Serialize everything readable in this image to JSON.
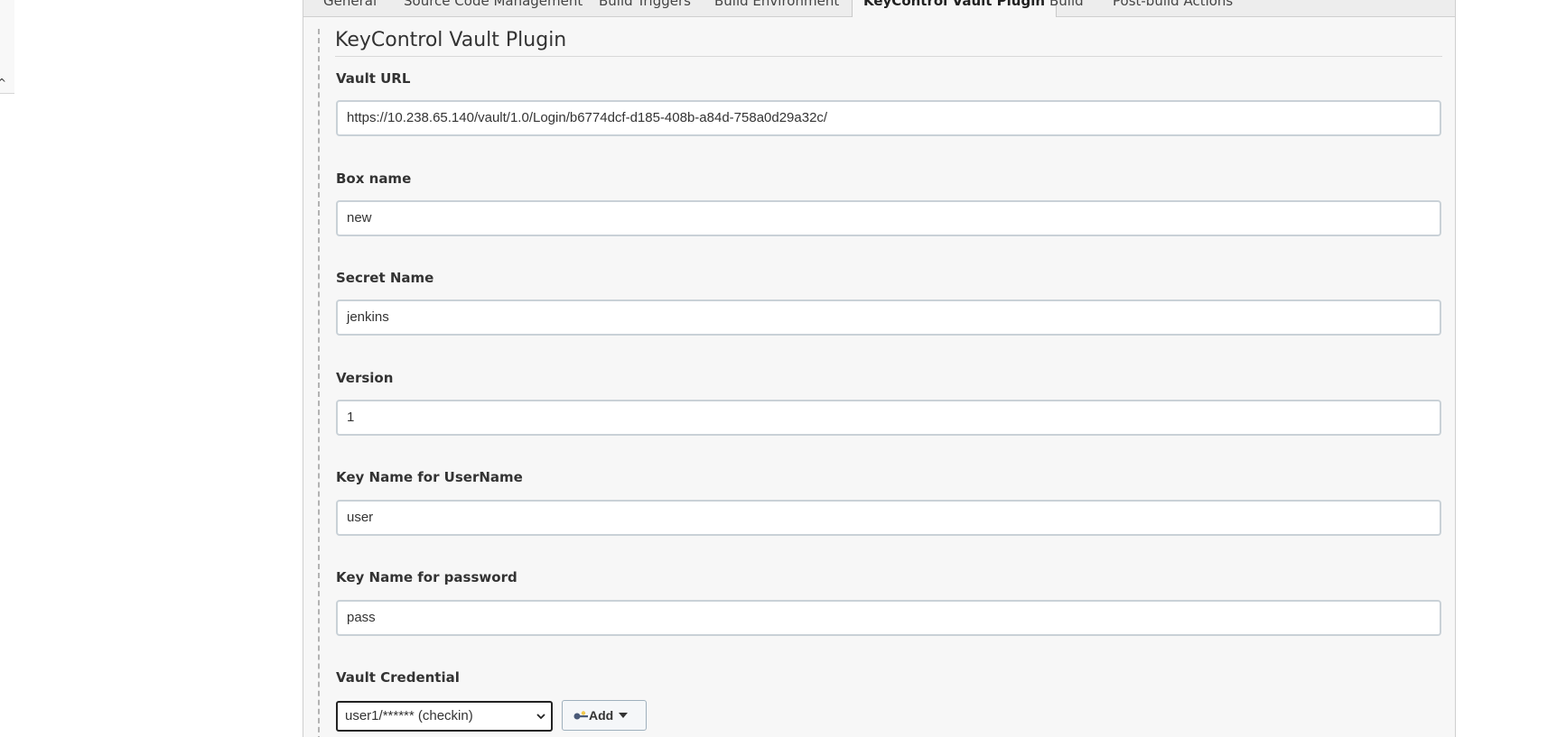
{
  "tabs": [
    {
      "label": "General"
    },
    {
      "label": "Source Code Management"
    },
    {
      "label": "Build Triggers"
    },
    {
      "label": "Build Environment"
    },
    {
      "label": "KeyControl Vault Plugin",
      "active": true
    },
    {
      "label": "Build"
    },
    {
      "label": "Post-build Actions"
    }
  ],
  "section": {
    "title": "KeyControl Vault Plugin"
  },
  "fields": {
    "vault_url": {
      "label": "Vault URL",
      "value": "https://10.238.65.140/vault/1.0/Login/b6774dcf-d185-408b-a84d-758a0d29a32c/"
    },
    "box_name": {
      "label": "Box name",
      "value": "new"
    },
    "secret_name": {
      "label": "Secret Name",
      "value": "jenkins"
    },
    "version": {
      "label": "Version",
      "value": "1"
    },
    "key_username": {
      "label": "Key Name for UserName",
      "value": "user"
    },
    "key_password": {
      "label": "Key Name for password",
      "value": "pass"
    },
    "vault_credential": {
      "label": "Vault Credential",
      "selected": "user1/****** (checkin)"
    }
  },
  "buttons": {
    "add_label": "Add"
  },
  "icons": {
    "add_button_icon": "key-icon",
    "dropdown_caret": "chevron-down-icon"
  },
  "colors": {
    "tab_bar_bg": "#ededed",
    "panel_bg": "#f7f7f7",
    "input_border": "#c9d1d7",
    "text": "#333333"
  }
}
